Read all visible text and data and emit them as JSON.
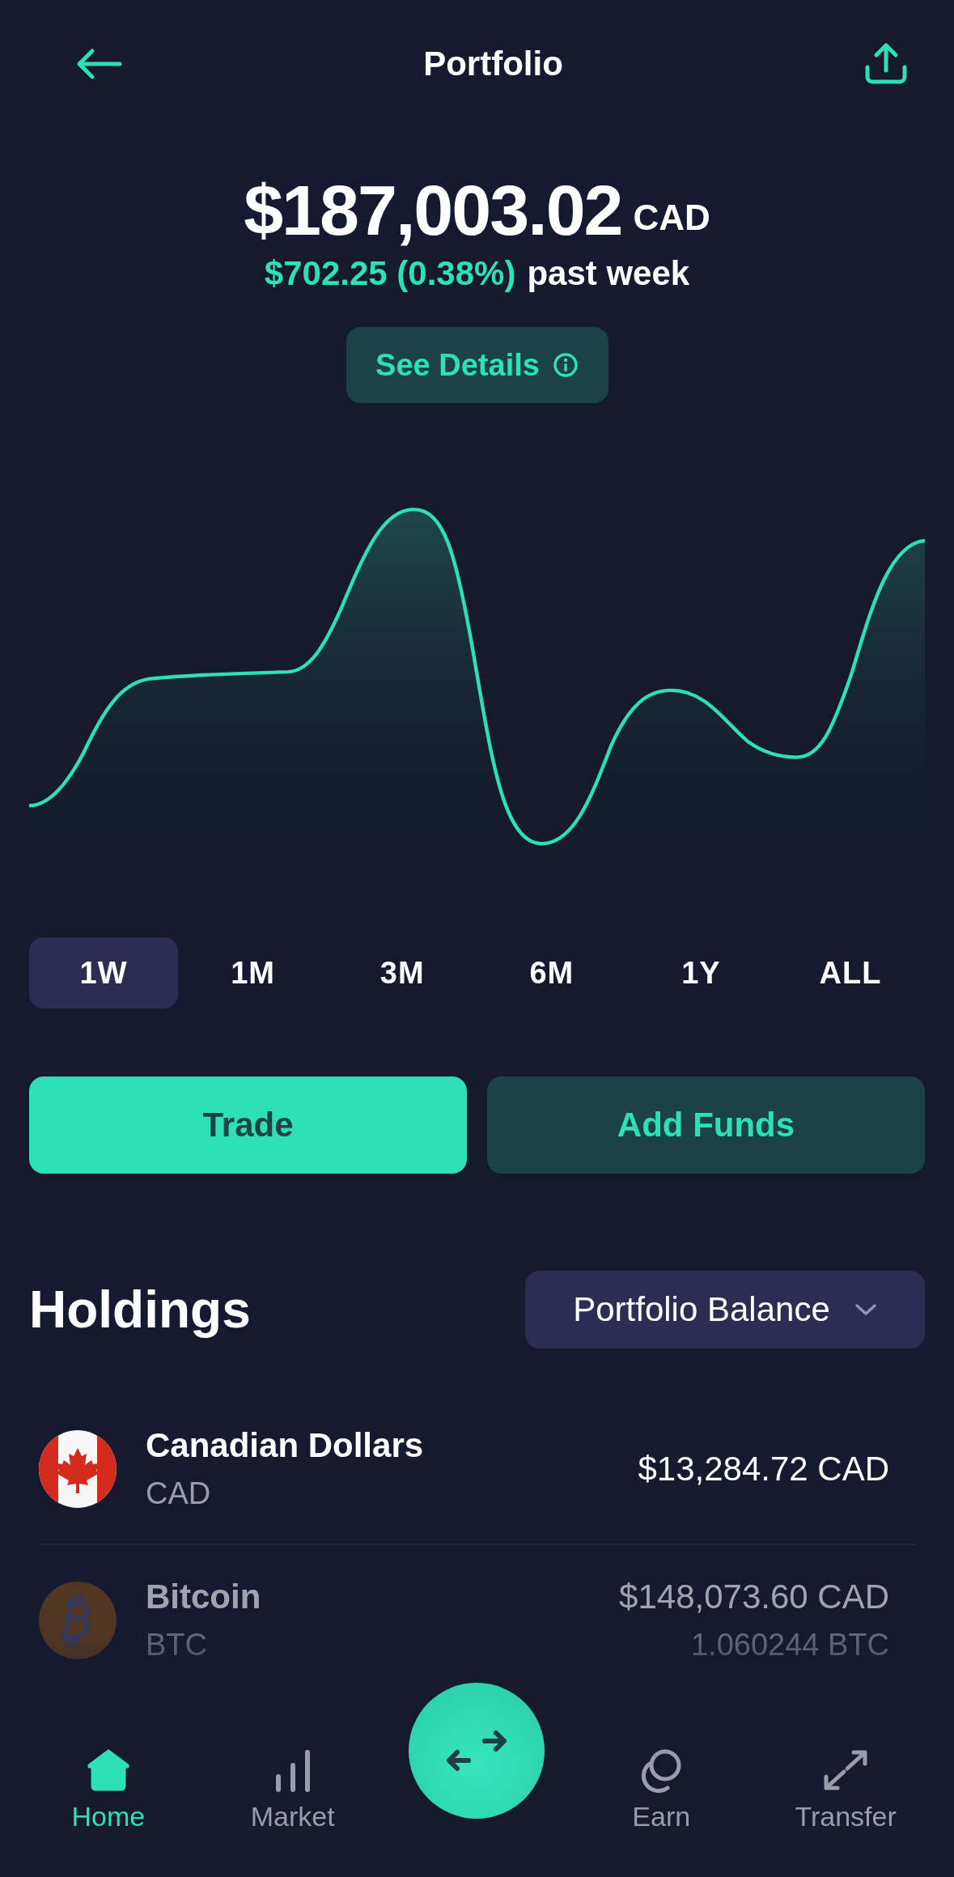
{
  "header": {
    "title": "Portfolio"
  },
  "balance": {
    "amount": "$187,003.02",
    "currency": "CAD",
    "change": "$702.25 (0.38%)",
    "period": "past week"
  },
  "details_button": {
    "label": "See Details"
  },
  "ranges": [
    {
      "label": "1W",
      "selected": true
    },
    {
      "label": "1M",
      "selected": false
    },
    {
      "label": "3M",
      "selected": false
    },
    {
      "label": "6M",
      "selected": false
    },
    {
      "label": "1Y",
      "selected": false
    },
    {
      "label": "ALL",
      "selected": false
    }
  ],
  "actions": [
    {
      "label": "Trade",
      "kind": "primary"
    },
    {
      "label": "Add Funds",
      "kind": "secondary"
    }
  ],
  "holdings": {
    "title": "Holdings",
    "sort": "Portfolio Balance",
    "rows": [
      {
        "kind": "cad",
        "name": "Canadian Dollars",
        "code": "CAD",
        "value": "$13,284.72 CAD"
      },
      {
        "kind": "btc",
        "name": "Bitcoin",
        "code": "BTC",
        "value": "$148,073.60 CAD",
        "amount": "1.060244 BTC"
      }
    ]
  },
  "nav": [
    {
      "kind": "home",
      "label": "Home",
      "selected": true
    },
    {
      "kind": "market",
      "label": "Market",
      "selected": false
    },
    {
      "kind": "swap"
    },
    {
      "kind": "earn",
      "label": "Earn",
      "selected": false
    },
    {
      "kind": "transfer",
      "label": "Transfer",
      "selected": false
    }
  ]
}
